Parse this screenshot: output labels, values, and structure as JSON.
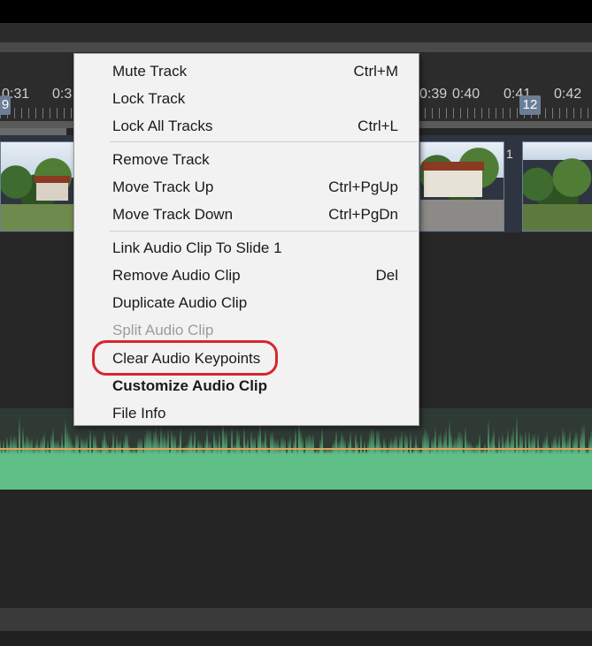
{
  "ruler": {
    "ticks": [
      "0:31",
      "0:3",
      "0:39",
      "0:40",
      "0:41",
      "0:42"
    ],
    "slide_markers": [
      "9",
      "12"
    ]
  },
  "video_track": {
    "clip_number": "1"
  },
  "context_menu": {
    "items": [
      {
        "label": "Mute Track",
        "shortcut": "Ctrl+M",
        "enabled": true
      },
      {
        "label": "Lock Track",
        "shortcut": "",
        "enabled": true
      },
      {
        "label": "Lock All Tracks",
        "shortcut": "Ctrl+L",
        "enabled": true
      },
      {
        "label": "Remove Track",
        "shortcut": "",
        "enabled": true
      },
      {
        "label": "Move Track Up",
        "shortcut": "Ctrl+PgUp",
        "enabled": true
      },
      {
        "label": "Move Track Down",
        "shortcut": "Ctrl+PgDn",
        "enabled": true
      },
      {
        "label": "Link Audio Clip To Slide 1",
        "shortcut": "",
        "enabled": true
      },
      {
        "label": "Remove Audio Clip",
        "shortcut": "Del",
        "enabled": true
      },
      {
        "label": "Duplicate Audio Clip",
        "shortcut": "",
        "enabled": true
      },
      {
        "label": "Split Audio Clip",
        "shortcut": "",
        "enabled": false
      },
      {
        "label": "Clear Audio Keypoints",
        "shortcut": "",
        "enabled": true,
        "highlighted": true
      },
      {
        "label": "Customize Audio Clip",
        "shortcut": "",
        "enabled": true,
        "bold": true
      },
      {
        "label": "File Info",
        "shortcut": "",
        "enabled": true
      }
    ]
  },
  "colors": {
    "highlight_ring": "#d7262e",
    "waveform": "#5fbf86",
    "keypoint_line": "#e3a45a",
    "slide_marker": "#6b7e95"
  }
}
